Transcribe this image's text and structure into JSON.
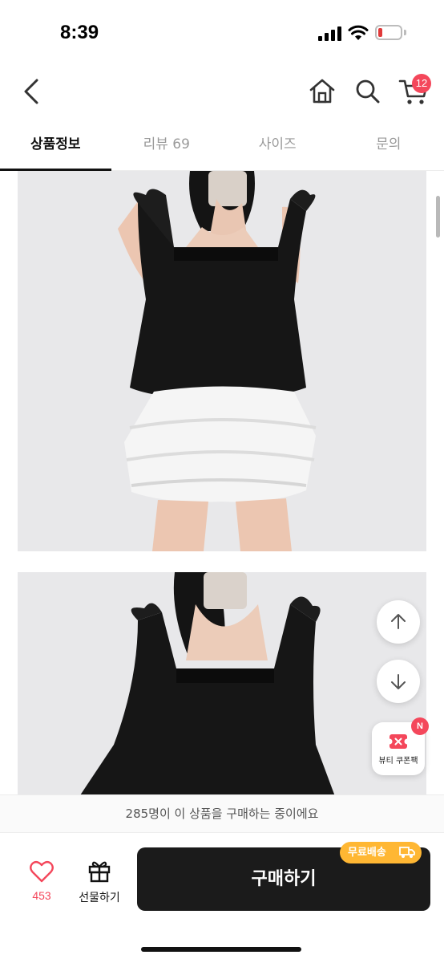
{
  "status_bar": {
    "time": "8:39",
    "battery_level": 0.2,
    "battery_color": "#e03a3a"
  },
  "header": {
    "back_icon": "chevron-left-icon",
    "home_icon": "home-icon",
    "search_icon": "search-icon",
    "cart_icon": "cart-icon",
    "cart_count": "12"
  },
  "tabs": [
    {
      "label": "상품정보",
      "active": true
    },
    {
      "label": "리뷰 69",
      "active": false
    },
    {
      "label": "사이즈",
      "active": false
    },
    {
      "label": "문의",
      "active": false
    }
  ],
  "floating": {
    "scroll_up_icon": "arrow-up-icon",
    "scroll_down_icon": "arrow-down-icon",
    "coupon_label": "뷰티 쿠폰팩",
    "coupon_badge": "N"
  },
  "notice": {
    "text": "285명이 이 상품을 구매하는 중이에요"
  },
  "bottom_bar": {
    "like_count": "453",
    "gift_label": "선물하기",
    "buy_label": "구매하기",
    "free_shipping": "무료배송"
  },
  "colors": {
    "accent": "#f4475b",
    "buy_button": "#1b1b1b",
    "free_shipping": "#ffb733"
  }
}
